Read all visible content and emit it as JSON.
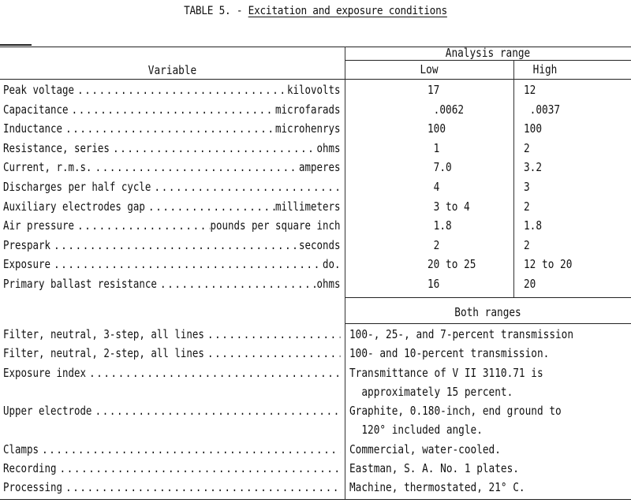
{
  "title": {
    "prefix": "TABLE 5. - ",
    "text": "Excitation and exposure conditions"
  },
  "headers": {
    "variable": "Variable",
    "analysis_range": "Analysis range",
    "low": "Low",
    "high": "High",
    "both_ranges": "Both ranges"
  },
  "rows": [
    {
      "name": "Peak voltage",
      "unit": "kilovolts",
      "low": "17",
      "high": "12"
    },
    {
      "name": "Capacitance",
      "unit": "microfarads",
      "low": " .0062",
      "high": " .0037"
    },
    {
      "name": "Inductance",
      "unit": "microhenrys",
      "low": "100",
      "high": "100"
    },
    {
      "name": "Resistance, series",
      "unit": "ohms",
      "low": " 1",
      "high": "2"
    },
    {
      "name": "Current, r.m.s.",
      "unit": "amperes",
      "low": " 7.0",
      "high": "3.2"
    },
    {
      "name": "Discharges per half cycle",
      "unit": "",
      "low": " 4",
      "high": "3"
    },
    {
      "name": "Auxiliary electrodes gap",
      "unit": "millimeters",
      "low": " 3 to 4",
      "high": "2"
    },
    {
      "name": "Air pressure",
      "unit": "pounds per square inch",
      "low": " 1.8",
      "high": "1.8"
    },
    {
      "name": "Prespark",
      "unit": "seconds",
      "low": " 2",
      "high": "2"
    },
    {
      "name": "Exposure",
      "unit": "do.",
      "low": "20 to 25",
      "high": "12 to 20"
    },
    {
      "name": "Primary ballast resistance",
      "unit": "ohms",
      "low": "16",
      "high": "20"
    }
  ],
  "both_rows": [
    {
      "name": "Filter, neutral, 3-step, all lines",
      "lines": [
        "100-, 25-, and 7-percent transmission"
      ]
    },
    {
      "name": "Filter, neutral, 2-step, all lines",
      "lines": [
        "100- and 10-percent transmission."
      ]
    },
    {
      "name": "Exposure index",
      "lines": [
        "Transmittance of V II 3110.71 is",
        "  approximately 15 percent."
      ]
    },
    {
      "name": "Upper electrode",
      "lines": [
        "Graphite, 0.180-inch, end ground to",
        "  120° included angle."
      ]
    },
    {
      "name": "Clamps",
      "lines": [
        "Commercial, water-cooled."
      ]
    },
    {
      "name": "Recording",
      "lines": [
        "Eastman, S. A. No. 1 plates."
      ]
    },
    {
      "name": "Processing",
      "lines": [
        "Machine, thermostated, 21° C."
      ]
    }
  ]
}
